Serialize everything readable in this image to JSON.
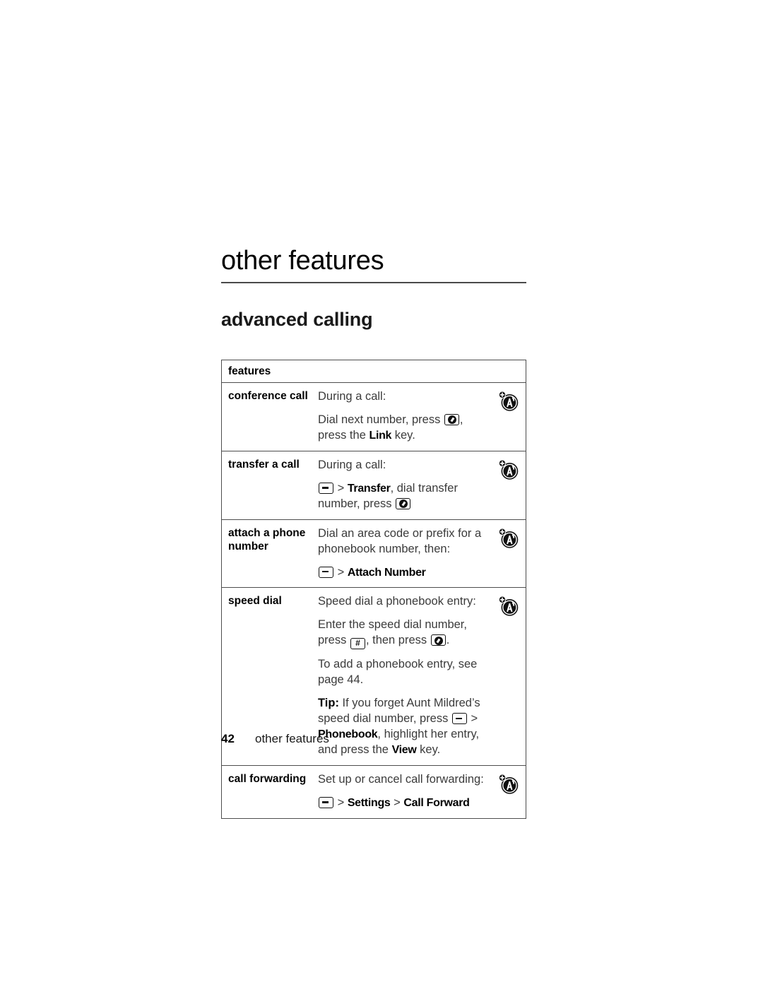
{
  "page": {
    "chapter_title": "other features",
    "section_title": "advanced calling"
  },
  "table": {
    "header_label": "features",
    "rows": [
      {
        "label": "conference call",
        "icon": "network-a-tower-icon",
        "paragraphs": [
          {
            "parts": [
              {
                "t": "text",
                "v": "During a call:"
              }
            ]
          },
          {
            "parts": [
              {
                "t": "text",
                "v": "Dial next number, press "
              },
              {
                "t": "key",
                "v": "send-key"
              },
              {
                "t": "text",
                "v": ", press the "
              },
              {
                "t": "ui",
                "v": "Link"
              },
              {
                "t": "text",
                "v": " key."
              }
            ]
          }
        ]
      },
      {
        "label": "transfer a call",
        "icon": "network-a-tower-icon",
        "paragraphs": [
          {
            "parts": [
              {
                "t": "text",
                "v": "During a call:"
              }
            ]
          },
          {
            "parts": [
              {
                "t": "key",
                "v": "menu-key"
              },
              {
                "t": "gt",
                "v": " > "
              },
              {
                "t": "ui",
                "v": "Transfer"
              },
              {
                "t": "text",
                "v": ", dial transfer number, press "
              },
              {
                "t": "key",
                "v": "send-key"
              }
            ]
          }
        ]
      },
      {
        "label": "attach a phone number",
        "icon": "network-a-tower-icon",
        "paragraphs": [
          {
            "parts": [
              {
                "t": "text",
                "v": "Dial an area code or prefix for a phonebook number, then:"
              }
            ]
          },
          {
            "parts": [
              {
                "t": "key",
                "v": "menu-key"
              },
              {
                "t": "gt",
                "v": " > "
              },
              {
                "t": "ui",
                "v": "Attach Number"
              }
            ]
          }
        ]
      },
      {
        "label": "speed dial",
        "icon": "network-a-tower-icon",
        "paragraphs": [
          {
            "parts": [
              {
                "t": "text",
                "v": "Speed dial a phonebook entry:"
              }
            ]
          },
          {
            "parts": [
              {
                "t": "text",
                "v": "Enter the speed dial number, press "
              },
              {
                "t": "key",
                "v": "hash-key"
              },
              {
                "t": "text",
                "v": ", then press "
              },
              {
                "t": "key",
                "v": "send-key"
              },
              {
                "t": "text",
                "v": "."
              }
            ]
          },
          {
            "parts": [
              {
                "t": "text",
                "v": "To add a phonebook entry, see page 44."
              }
            ]
          },
          {
            "parts": [
              {
                "t": "b",
                "v": "Tip:"
              },
              {
                "t": "text",
                "v": " If you forget Aunt Mildred’s speed dial number, press "
              },
              {
                "t": "key",
                "v": "menu-key"
              },
              {
                "t": "gt",
                "v": " > "
              },
              {
                "t": "ui",
                "v": "Phonebook"
              },
              {
                "t": "text",
                "v": ", highlight her entry, and press the "
              },
              {
                "t": "ui",
                "v": "View"
              },
              {
                "t": "text",
                "v": " key."
              }
            ]
          }
        ]
      },
      {
        "label": "call forwarding",
        "icon": "network-a-tower-icon",
        "paragraphs": [
          {
            "parts": [
              {
                "t": "text",
                "v": "Set up or cancel call forwarding:"
              }
            ]
          },
          {
            "parts": [
              {
                "t": "key",
                "v": "menu-key"
              },
              {
                "t": "gt",
                "v": " > "
              },
              {
                "t": "ui",
                "v": "Settings"
              },
              {
                "t": "gt",
                "v": " > "
              },
              {
                "t": "ui",
                "v": "Call Forward"
              }
            ]
          }
        ]
      }
    ]
  },
  "footer": {
    "page_number": "42",
    "text": "other features"
  },
  "colors": {
    "rule": "#4d4d4d",
    "body_text": "#3b3b3b",
    "bold_text": "#000000"
  }
}
